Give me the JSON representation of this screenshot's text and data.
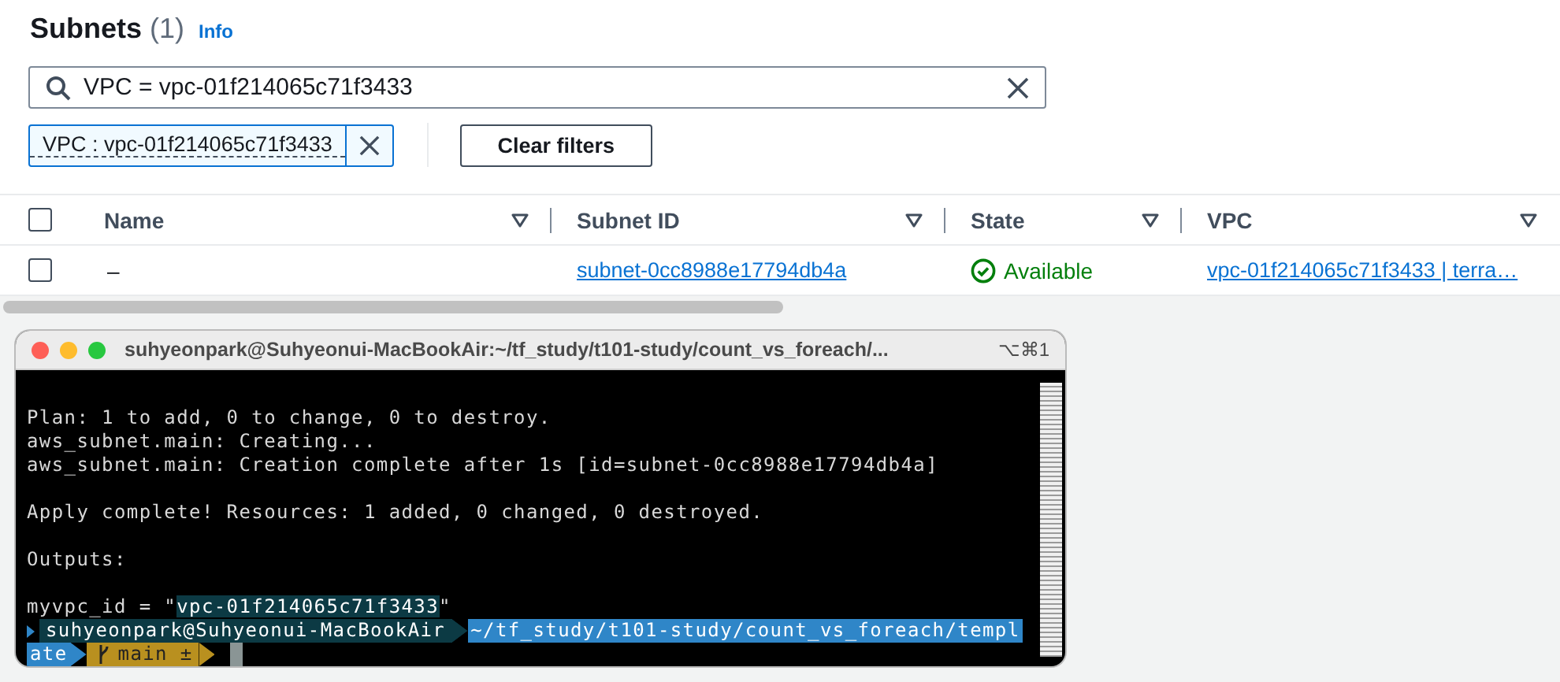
{
  "header": {
    "title": "Subnets",
    "count": "(1)",
    "info": "Info"
  },
  "search": {
    "value": "VPC = vpc-01f214065c71f3433"
  },
  "filter_tokens": [
    {
      "label": "VPC : vpc-01f214065c71f3433"
    }
  ],
  "clear_button": "Clear filters",
  "table": {
    "select_all": {
      "checked": false
    },
    "columns": [
      {
        "label": "Name"
      },
      {
        "label": "Subnet ID"
      },
      {
        "label": "State"
      },
      {
        "label": "VPC"
      }
    ],
    "rows": [
      {
        "selected": false,
        "name": "–",
        "subnet_id": "subnet-0cc8988e17794db4a",
        "state": "Available",
        "vpc": "vpc-01f214065c71f3433 | terra…"
      }
    ]
  },
  "terminal": {
    "title": "suhyeonpark@Suhyeonui-MacBookAir:~/tf_study/t101-study/count_vs_foreach/...",
    "shortcut": "⌥⌘1",
    "lines": [
      {
        "kind": "blank"
      },
      {
        "kind": "text",
        "text": "Plan: 1 to add, 0 to change, 0 to destroy."
      },
      {
        "kind": "text",
        "text": "aws_subnet.main: Creating..."
      },
      {
        "kind": "text",
        "text": "aws_subnet.main: Creation complete after 1s [id=subnet-0cc8988e17794db4a]"
      },
      {
        "kind": "blank"
      },
      {
        "kind": "text",
        "text": "Apply complete! Resources: 1 added, 0 changed, 0 destroyed."
      },
      {
        "kind": "blank"
      },
      {
        "kind": "text",
        "text": "Outputs:"
      },
      {
        "kind": "blank"
      },
      {
        "kind": "output",
        "prefix": "myvpc_id = \"",
        "highlight": "vpc-01f214065c71f3433",
        "suffix": "\""
      }
    ],
    "prompt": {
      "user": "suhyeonpark@Suhyeonui-MacBookAir",
      "path": "~/tf_study/t101-study/count_vs_foreach/templ",
      "path_rest": "ate",
      "branch": "main ±"
    }
  }
}
